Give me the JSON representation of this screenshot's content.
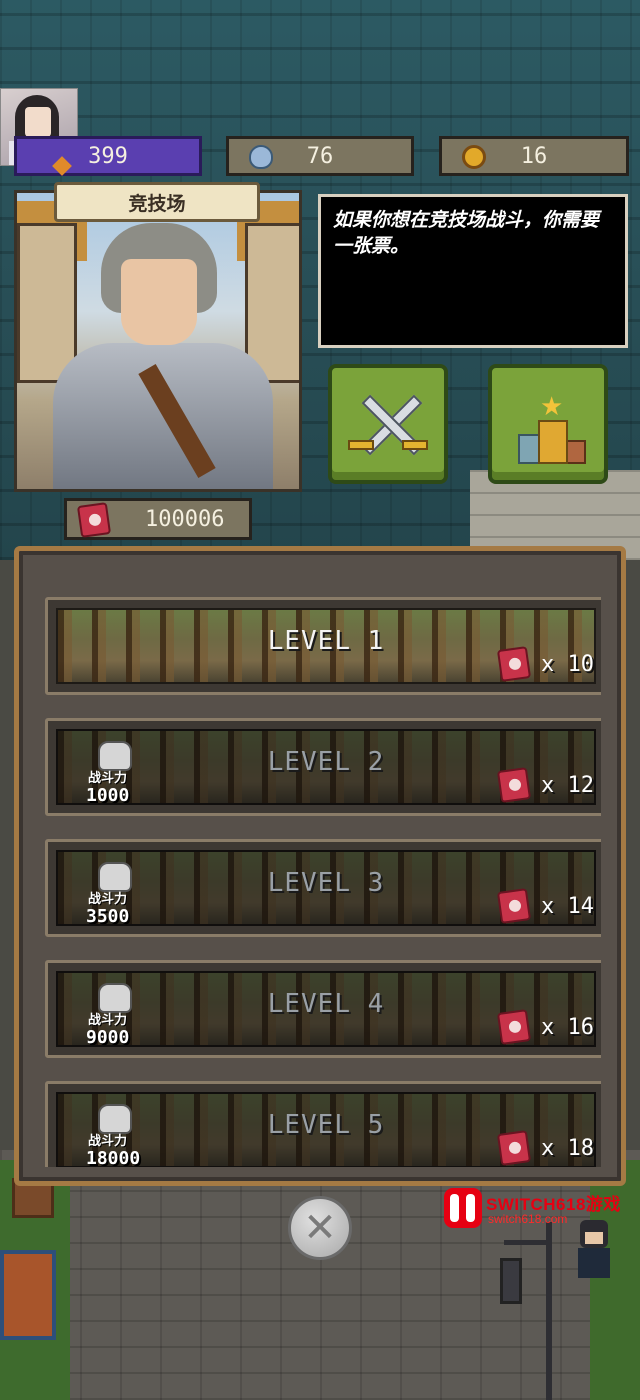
{
  "resources": {
    "gems": "399",
    "potions": "76",
    "coins": "16"
  },
  "arena": {
    "title": "竞技场",
    "message": "如果你想在竞技场战斗，你需要一张票。",
    "tickets": "100006"
  },
  "levels": [
    {
      "name": "LEVEL 1",
      "cost": "x 10",
      "locked": false
    },
    {
      "name": "LEVEL 2",
      "cost": "x 12",
      "locked": true,
      "power_label": "战斗力",
      "power": "1000"
    },
    {
      "name": "LEVEL 3",
      "cost": "x 14",
      "locked": true,
      "power_label": "战斗力",
      "power": "3500"
    },
    {
      "name": "LEVEL 4",
      "cost": "x 16",
      "locked": true,
      "power_label": "战斗力",
      "power": "9000"
    },
    {
      "name": "LEVEL 5",
      "cost": "x 18",
      "locked": true,
      "power_label": "战斗力",
      "power": "18000"
    }
  ],
  "watermark": {
    "brand": "SWITCH618游戏",
    "site": "switch618.com"
  },
  "icons": {
    "gems": "gem-icon",
    "potions": "potion-icon",
    "coins": "coin-icon",
    "ticket": "ticket-icon",
    "battle": "crossed-swords-icon",
    "ranking": "podium-icon",
    "power": "fist-icon",
    "close": "close-icon"
  },
  "colors": {
    "gem_bar": "#5a3fb0",
    "resource_bar": "#7c7560",
    "action_button": "#7ba33a",
    "panel_border": "#a57a44",
    "dialog_bg": "#000000"
  }
}
